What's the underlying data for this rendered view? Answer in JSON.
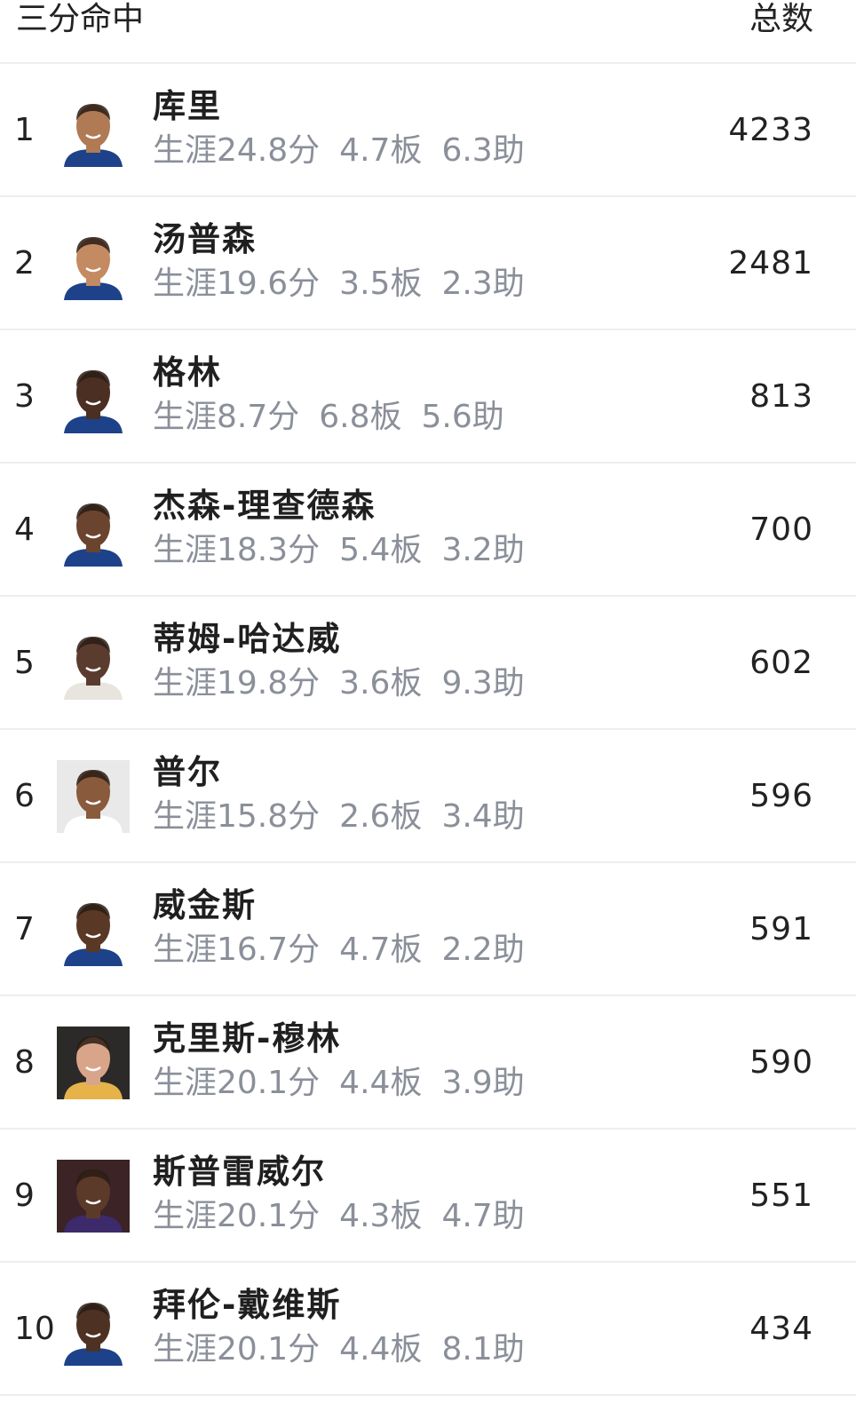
{
  "header": {
    "title": "三分命中",
    "total_label": "总数"
  },
  "players": [
    {
      "rank": "1",
      "name": "库里",
      "points": "生涯24.8分",
      "rebounds": "4.7板",
      "assists": "6.3助",
      "total": "4233",
      "skin": "#b07a55",
      "bg": "#ffffff",
      "jersey": "#1d428a"
    },
    {
      "rank": "2",
      "name": "汤普森",
      "points": "生涯19.6分",
      "rebounds": "3.5板",
      "assists": "2.3助",
      "total": "2481",
      "skin": "#c48a62",
      "bg": "#ffffff",
      "jersey": "#1d428a"
    },
    {
      "rank": "3",
      "name": "格林",
      "points": "生涯8.7分",
      "rebounds": "6.8板",
      "assists": "5.6助",
      "total": "813",
      "skin": "#4a2f22",
      "bg": "#ffffff",
      "jersey": "#1d428a"
    },
    {
      "rank": "4",
      "name": "杰森-理查德森",
      "points": "生涯18.3分",
      "rebounds": "5.4板",
      "assists": "3.2助",
      "total": "700",
      "skin": "#6b4430",
      "bg": "#ffffff",
      "jersey": "#1d428a"
    },
    {
      "rank": "5",
      "name": "蒂姆-哈达威",
      "points": "生涯19.8分",
      "rebounds": "3.6板",
      "assists": "9.3助",
      "total": "602",
      "skin": "#5a3c2e",
      "bg": "#ffffff",
      "jersey": "#e8e4de"
    },
    {
      "rank": "6",
      "name": "普尔",
      "points": "生涯15.8分",
      "rebounds": "2.6板",
      "assists": "3.4助",
      "total": "596",
      "skin": "#8a5a3c",
      "bg": "#e9e9e9",
      "jersey": "#ffffff"
    },
    {
      "rank": "7",
      "name": "威金斯",
      "points": "生涯16.7分",
      "rebounds": "4.7板",
      "assists": "2.2助",
      "total": "591",
      "skin": "#5a3826",
      "bg": "#ffffff",
      "jersey": "#1d428a"
    },
    {
      "rank": "8",
      "name": "克里斯-穆林",
      "points": "生涯20.1分",
      "rebounds": "4.4板",
      "assists": "3.9助",
      "total": "590",
      "skin": "#d9a58a",
      "bg": "#2c2a28",
      "jersey": "#e6b34a"
    },
    {
      "rank": "9",
      "name": "斯普雷威尔",
      "points": "生涯20.1分",
      "rebounds": "4.3板",
      "assists": "4.7助",
      "total": "551",
      "skin": "#5c3a2a",
      "bg": "#3b2326",
      "jersey": "#3d2a6b"
    },
    {
      "rank": "10",
      "name": "拜伦-戴维斯",
      "points": "生涯20.1分",
      "rebounds": "4.4板",
      "assists": "8.1助",
      "total": "434",
      "skin": "#4d3224",
      "bg": "#ffffff",
      "jersey": "#1d428a"
    }
  ]
}
